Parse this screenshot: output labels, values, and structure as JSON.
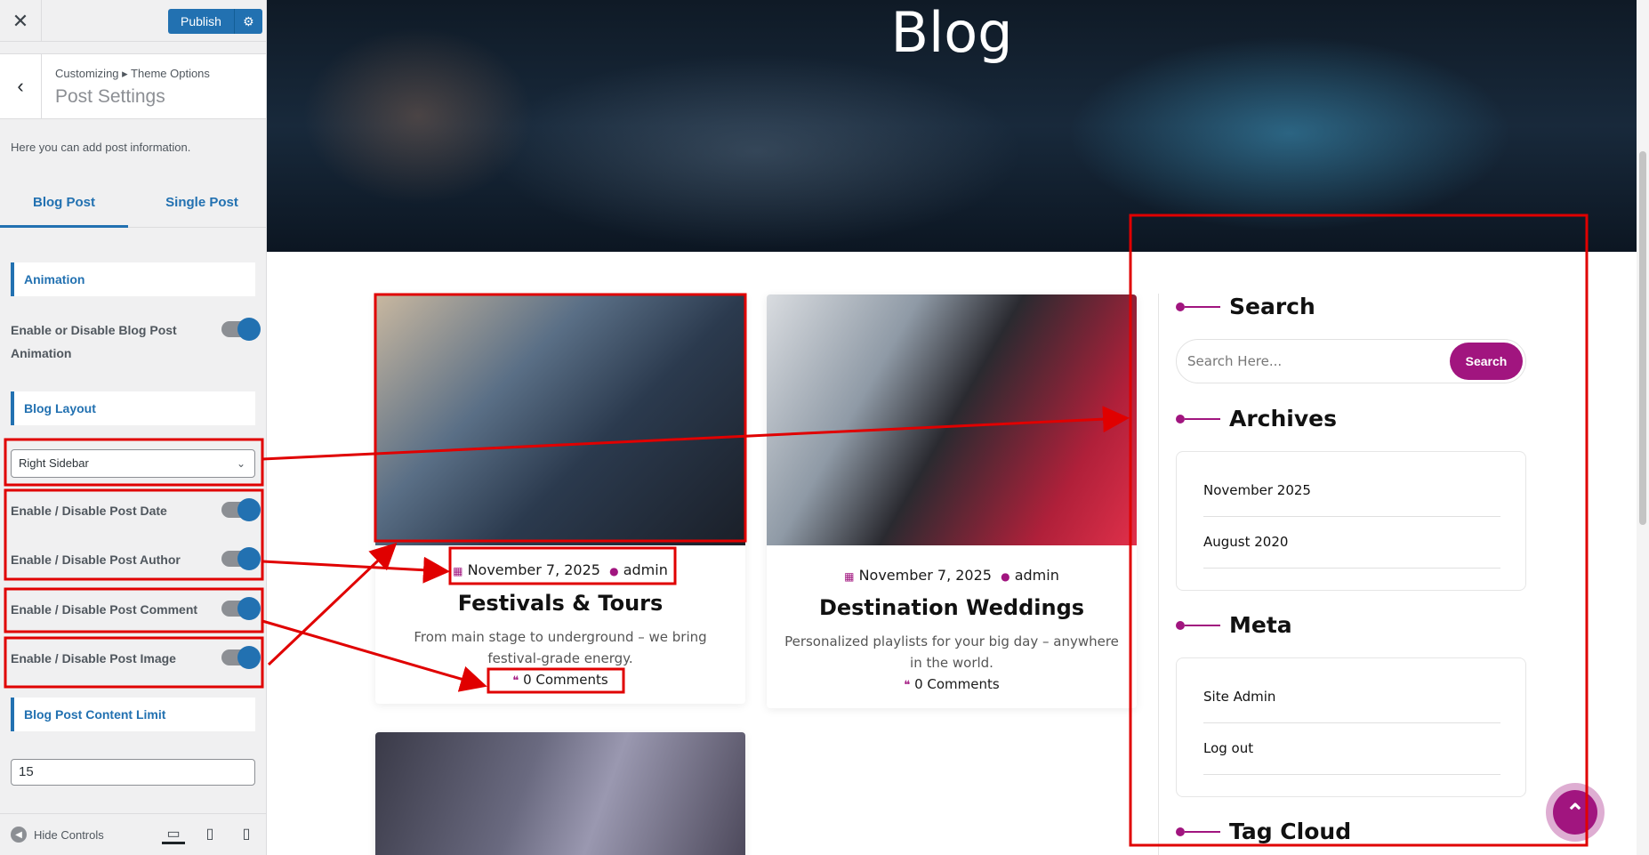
{
  "customizer": {
    "publish_label": "Publish",
    "breadcrumb": "Customizing ▸ Theme Options",
    "title": "Post Settings",
    "description": "Here you can add post information.",
    "tabs": [
      {
        "label": "Blog Post",
        "active": true
      },
      {
        "label": "Single Post",
        "active": false
      }
    ],
    "sections": {
      "animation": "Animation",
      "blog_layout": "Blog Layout",
      "content_limit": "Blog Post Content Limit"
    },
    "toggles": {
      "animation": {
        "label": "Enable or Disable Blog Post Animation",
        "on": true
      },
      "post_date": {
        "label": "Enable / Disable Post Date",
        "on": true
      },
      "post_author": {
        "label": "Enable / Disable Post Author",
        "on": true
      },
      "post_comment": {
        "label": "Enable / Disable Post Comment",
        "on": true
      },
      "post_image": {
        "label": "Enable / Disable Post Image",
        "on": true
      }
    },
    "layout_select": "Right Sidebar",
    "content_limit_value": "15",
    "hide_controls": "Hide Controls"
  },
  "preview": {
    "hero_title": "Blog",
    "posts": [
      {
        "date": "November 7, 2025",
        "author": "admin",
        "title": "Festivals & Tours",
        "excerpt": "From main stage to underground – we bring festival-grade energy.",
        "comments": "0 Comments"
      },
      {
        "date": "November 7, 2025",
        "author": "admin",
        "title": "Destination Weddings",
        "excerpt": "Personalized playlists for your big day – anywhere in the world.",
        "comments": "0 Comments"
      }
    ],
    "sidebar": {
      "search_title": "Search",
      "search_placeholder": "Search Here...",
      "search_button": "Search",
      "archives_title": "Archives",
      "archives": [
        "November 2025",
        "August 2020"
      ],
      "meta_title": "Meta",
      "meta": [
        "Site Admin",
        "Log out"
      ],
      "tag_cloud_title": "Tag Cloud"
    }
  },
  "colors": {
    "wp_blue": "#2271b1",
    "accent": "#a1157f",
    "annotation": "#e00000"
  },
  "icons": [
    "close-icon",
    "gear-icon",
    "back-arrow-icon",
    "chevron-down-icon",
    "calendar-icon",
    "user-icon",
    "comments-icon",
    "desktop-icon",
    "tablet-icon",
    "mobile-icon",
    "double-chevron-up-icon"
  ]
}
